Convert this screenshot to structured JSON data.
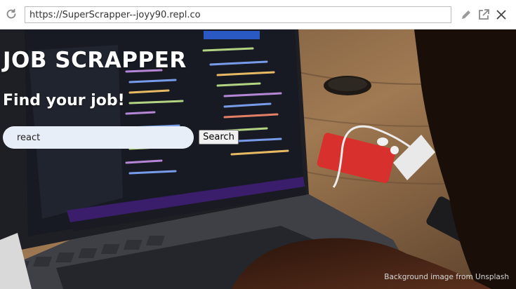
{
  "browser": {
    "url": "https://SuperScrapper--joyy90.repl.co",
    "icons": [
      "reload-icon",
      "edit-icon",
      "external-link-icon",
      "close-icon"
    ]
  },
  "page": {
    "title": "JOB SCRAPPER",
    "subtitle": "Find your job!",
    "search": {
      "value": "react",
      "button_label": "Search"
    },
    "credit": "Background image from Unsplash"
  },
  "colors": {
    "title_text": "#ffffff",
    "input_background": "#e8eef7",
    "credit_text": "#d8d8d8"
  }
}
